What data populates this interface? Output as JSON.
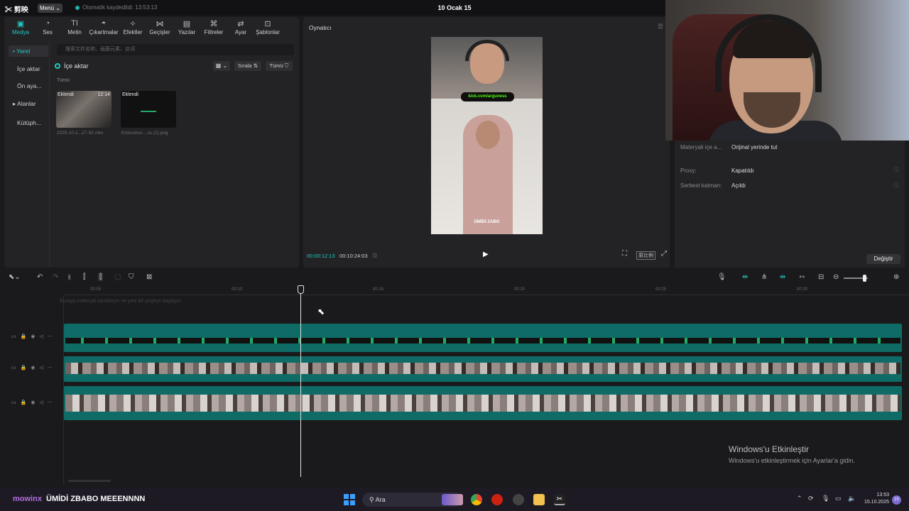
{
  "titlebar": {
    "logo": "✂ 剪映",
    "menu": "Menü ⌄",
    "autosave": "Otomatik kaydedildi: 13:53:13",
    "project_title": "10 Ocak 15"
  },
  "toolbar": {
    "items": [
      {
        "label": "Medya",
        "icon": "media-icon"
      },
      {
        "label": "Ses",
        "icon": "audio-icon"
      },
      {
        "label": "Metin",
        "icon": "text-icon"
      },
      {
        "label": "Çıkartmalar",
        "icon": "sticker-icon"
      },
      {
        "label": "Efektler",
        "icon": "effects-icon"
      },
      {
        "label": "Geçişler",
        "icon": "transitions-icon"
      },
      {
        "label": "Yazılar",
        "icon": "captions-icon"
      },
      {
        "label": "Filtreler",
        "icon": "filters-icon"
      },
      {
        "label": "Ayar",
        "icon": "adjust-icon"
      },
      {
        "label": "Şablonlar",
        "icon": "templates-icon"
      }
    ]
  },
  "sidebar": {
    "items": [
      {
        "label": "• Yerel"
      },
      {
        "label": "İçe aktar"
      },
      {
        "label": "Ön aya..."
      },
      {
        "label": "▸ Alanlar"
      },
      {
        "label": "Kütüph..."
      }
    ]
  },
  "media": {
    "search_placeholder": "搜索文件名称、画面元素、台词",
    "import_label": "İçe aktar",
    "view_label": "▦ ⌄",
    "sort_label": "Sırala ⇅",
    "all_label": "Tümü ⛉",
    "section_label": "Tümü",
    "items": [
      {
        "tag": "Eklendi",
        "duration": "12:14",
        "name": "2025-10-1...27-50.mkv"
      },
      {
        "tag": "Eklendi",
        "duration": "",
        "name": "Kickcoinsr....ss (2).png"
      }
    ]
  },
  "player": {
    "title": "Oynatıcı",
    "kick_banner": "kick.com/arguness",
    "caption": "ÜMİDİ ZABO",
    "time_current": "00:00:12:13",
    "time_total": "00:10:24:03",
    "ratio_label": "原比例"
  },
  "properties": {
    "rows": [
      {
        "label": "Materyali içe a...",
        "value": "Orijinal yerinde tut"
      },
      {
        "label": "Proxy:",
        "value": "Kapatıldı"
      },
      {
        "label": "Serbest katman:",
        "value": "Açıldı"
      }
    ],
    "change_button": "Değiştir"
  },
  "timeline": {
    "ticks": [
      "00:05",
      "00:10",
      "00:15",
      "00:20",
      "00:25",
      "00:30"
    ],
    "drop_hint": "Buraya materyal sürükleyin ve yeni bir projeye başlayın",
    "playhead_fraction": 0.28
  },
  "watermark": {
    "title": "Windows'u Etkinleştir",
    "subtitle": "Windows'u etkinleştirmek için Ayarlar'a gidin."
  },
  "overlay": {
    "name": "mowinx",
    "message": "ÜMİDİ ZBABO MEEENNNN"
  },
  "taskbar": {
    "search": "Ara",
    "time": "13:53",
    "date": "15.10.2025",
    "notifications": "15"
  },
  "colors": {
    "accent": "#20c9c0",
    "clip": "#0f6b66",
    "kick_green": "#53fc18"
  }
}
